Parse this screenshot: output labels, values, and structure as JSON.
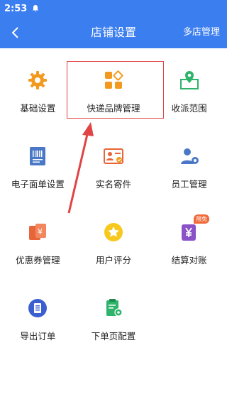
{
  "status_bar": {
    "time": "2:53"
  },
  "header": {
    "title": "店铺设置",
    "right_action": "多店管理"
  },
  "menu": [
    {
      "label": "基础设置",
      "icon": "gear-icon"
    },
    {
      "label": "快递品牌管理",
      "icon": "brand-blocks-icon"
    },
    {
      "label": "收派范围",
      "icon": "map-pin-icon"
    },
    {
      "label": "电子面单设置",
      "icon": "barcode-icon"
    },
    {
      "label": "实名寄件",
      "icon": "id-card-icon"
    },
    {
      "label": "员工管理",
      "icon": "staff-icon"
    },
    {
      "label": "优惠券管理",
      "icon": "coupon-icon"
    },
    {
      "label": "用户评分",
      "icon": "star-icon"
    },
    {
      "label": "结算对账",
      "icon": "yen-wallet-icon",
      "badge": "限免"
    },
    {
      "label": "导出订单",
      "icon": "export-doc-icon"
    },
    {
      "label": "下单页配置",
      "icon": "order-config-icon"
    }
  ],
  "colors": {
    "primary": "#3b7ef0",
    "orange": "#f39a1e",
    "highlight": "#e04444"
  }
}
